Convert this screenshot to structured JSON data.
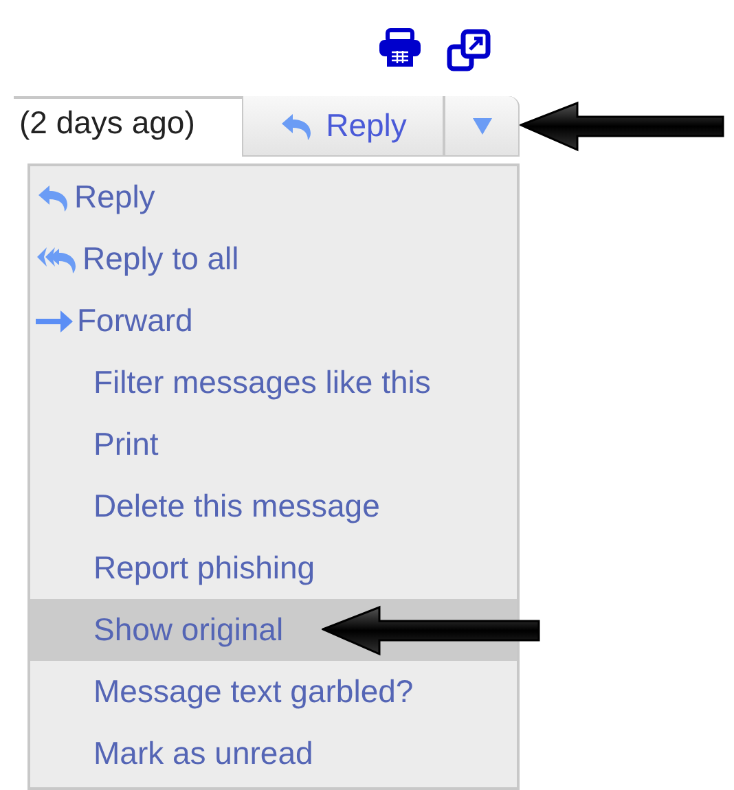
{
  "timestamp": "(2 days ago)",
  "reply_button": {
    "label": "Reply"
  },
  "menu": [
    {
      "kind": "reply",
      "label": "Reply",
      "selected": false
    },
    {
      "kind": "reply_all",
      "label": "Reply to all",
      "selected": false
    },
    {
      "kind": "forward",
      "label": "Forward",
      "selected": false
    },
    {
      "kind": "plain",
      "label": "Filter messages like this",
      "selected": false
    },
    {
      "kind": "plain",
      "label": "Print",
      "selected": false
    },
    {
      "kind": "plain",
      "label": "Delete this message",
      "selected": false
    },
    {
      "kind": "plain",
      "label": "Report phishing",
      "selected": false
    },
    {
      "kind": "plain",
      "label": "Show original",
      "selected": true
    },
    {
      "kind": "plain",
      "label": "Message text garbled?",
      "selected": false
    },
    {
      "kind": "plain",
      "label": "Mark as unread",
      "selected": false
    }
  ]
}
